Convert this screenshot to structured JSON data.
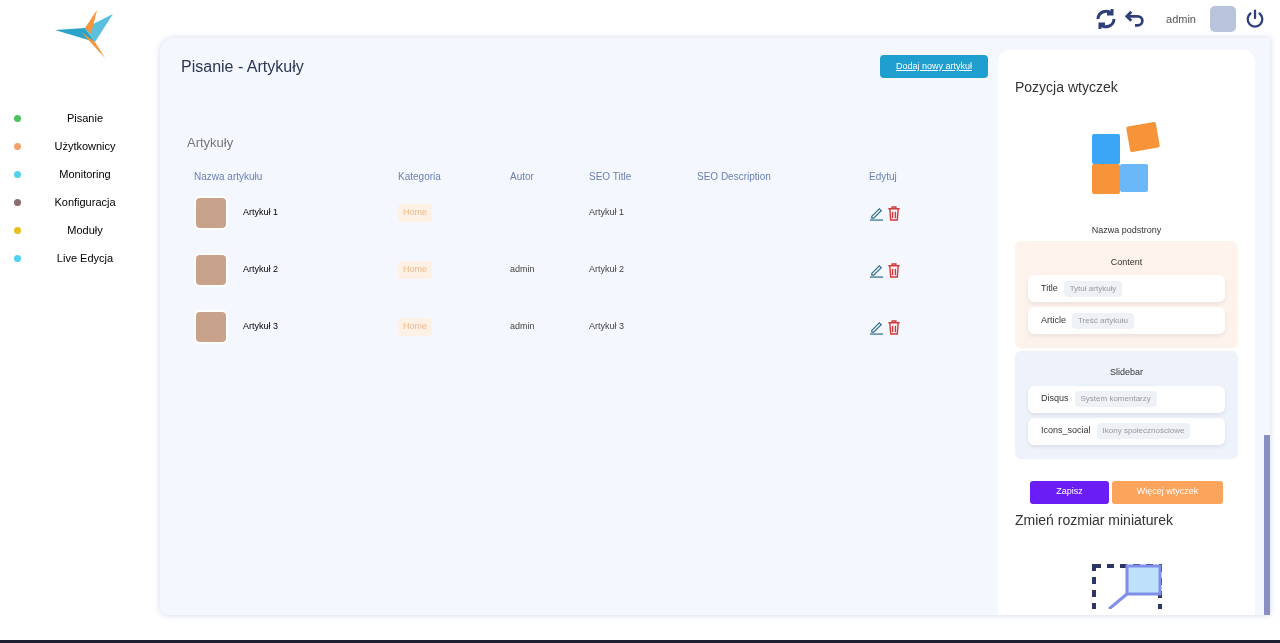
{
  "header": {
    "user": "admin"
  },
  "sidebar": {
    "items": [
      {
        "label": "Pisanie",
        "color": "#4cc35a"
      },
      {
        "label": "Użytkownicy",
        "color": "#f4a26c"
      },
      {
        "label": "Monitoring",
        "color": "#4fd1f0"
      },
      {
        "label": "Konfiguracja",
        "color": "#8a6d6d"
      },
      {
        "label": "Moduły",
        "color": "#e8c021"
      },
      {
        "label": "Live Edycja",
        "color": "#4fd1f0"
      }
    ]
  },
  "page": {
    "title": "Pisanie - Artykuły",
    "add_button": "Dodaj nowy artykuł",
    "section_title": "Artykuły"
  },
  "table": {
    "columns": [
      "Nazwa artykułu",
      "Kategoria",
      "Autor",
      "SEO Title",
      "SEO Description",
      "Edytuj"
    ],
    "rows": [
      {
        "name": "Artykuł 1",
        "category": "Home",
        "author": "",
        "seo_title": "Artykuł 1",
        "seo_description": ""
      },
      {
        "name": "Artykuł 2",
        "category": "Home",
        "author": "admin",
        "seo_title": "Artykuł 2",
        "seo_description": ""
      },
      {
        "name": "Artykuł 3",
        "category": "Home",
        "author": "admin",
        "seo_title": "Artykuł 3",
        "seo_description": ""
      }
    ]
  },
  "plugins": {
    "title": "Pozycja wtyczek",
    "subpage_label": "Nazwa podstrony",
    "groups": [
      {
        "title": "Content",
        "kind": "content",
        "items": [
          {
            "name": "Title",
            "value": "Tytuł artykuły"
          },
          {
            "name": "Article",
            "value": "Treść artykułu"
          }
        ]
      },
      {
        "title": "Slidebar",
        "kind": "sidebar",
        "items": [
          {
            "name": "Disqus",
            "value": "System komentarzy"
          },
          {
            "name": "Icons_social",
            "value": "Ikony społecznościowe"
          }
        ]
      }
    ],
    "save_button": "Zapisz",
    "more_button": "Więcej wtyczek"
  },
  "thumbnails": {
    "title": "Zmień rozmiar miniaturek"
  }
}
